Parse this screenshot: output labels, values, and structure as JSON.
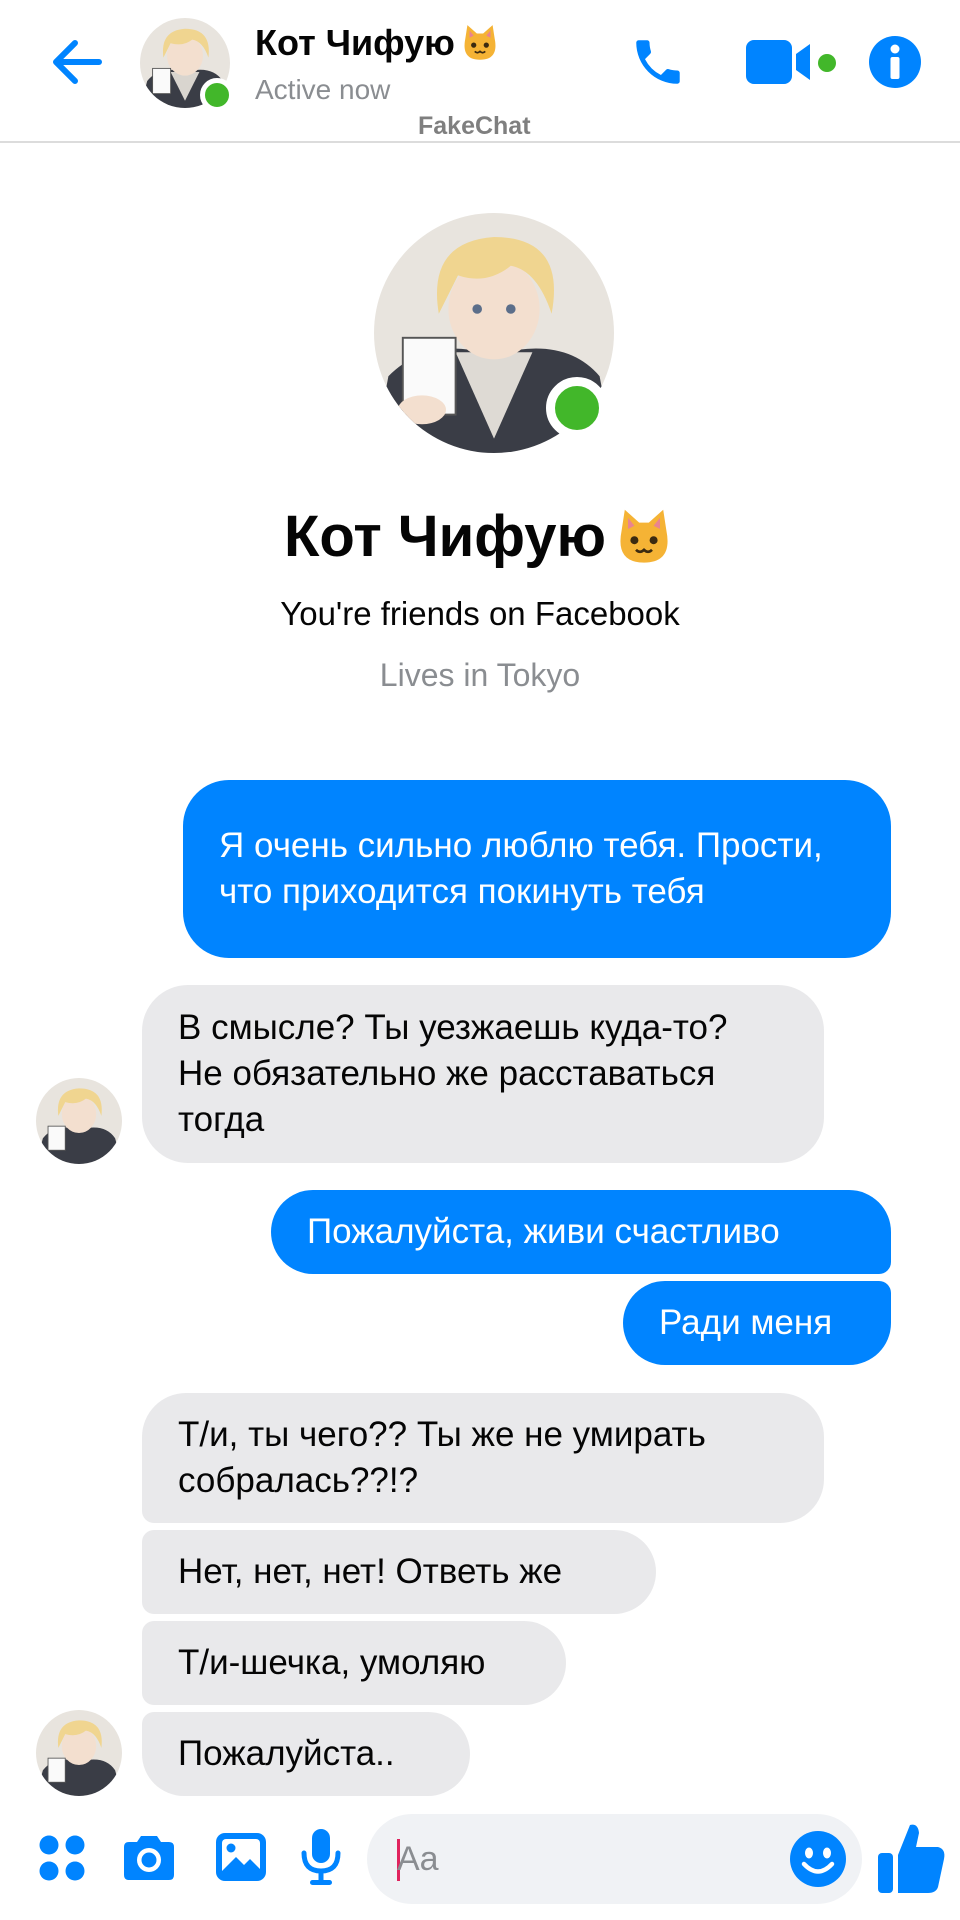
{
  "header": {
    "contact_name": "Кот Чифую",
    "status": "Active now",
    "watermark": "FakeChat"
  },
  "profile": {
    "name": "Кот Чифую",
    "friends_text": "You're friends on Facebook",
    "location": "Lives in Tokyo"
  },
  "messages": [
    {
      "side": "out",
      "text": "Я очень сильно люблю тебя. Прости, что приходится покинуть тебя"
    },
    {
      "side": "in",
      "text": "В смысле? Ты уезжаешь куда-то? Не обязательно же расставаться тогда"
    },
    {
      "side": "out",
      "text": "Пожалуйста, живи счастливо"
    },
    {
      "side": "out",
      "text": "Ради меня"
    },
    {
      "side": "in",
      "text": "Т/и, ты чего?? Ты же не умирать собралась??!?"
    },
    {
      "side": "in",
      "text": "Нет, нет, нет! Ответь же"
    },
    {
      "side": "in",
      "text": "Т/и-шечка, умоляю"
    },
    {
      "side": "in",
      "text": "Пожалуйста.."
    }
  ],
  "composer": {
    "placeholder": "Aa"
  },
  "colors": {
    "accent": "#0084ff",
    "incoming_bubble": "#e9e9eb",
    "presence": "#42b72a"
  },
  "icons": [
    "back-arrow-icon",
    "phone-icon",
    "video-camera-icon",
    "info-icon",
    "apps-grid-icon",
    "camera-icon",
    "gallery-icon",
    "microphone-icon",
    "emoji-icon",
    "thumbs-up-icon",
    "cat-emoji-icon"
  ]
}
